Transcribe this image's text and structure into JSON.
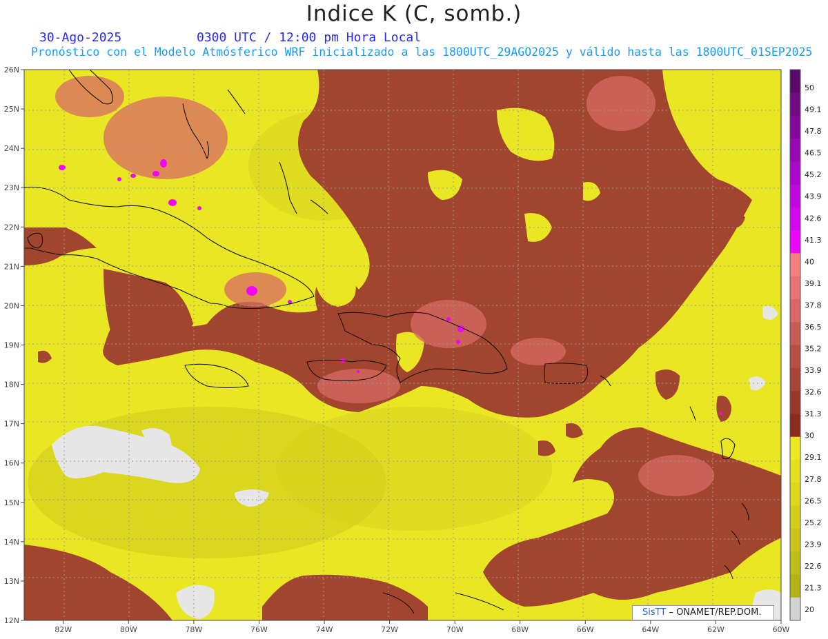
{
  "header": {
    "title": "Indice K (C, somb.)",
    "date": "30-Ago-2025",
    "time": "0300 UTC / 12:00 pm Hora Local",
    "subtitle": "Pronóstico con el Modelo Atmósferico WRF inicializado a las 1800UTC_29AGO2025 y válido hasta las  1800UTC_01SEP2025"
  },
  "credit": {
    "brand": "SisTT",
    "org": "– ONAMET/REP.DOM."
  },
  "map": {
    "lat_labels": [
      "26N",
      "25N",
      "24N",
      "23N",
      "22N",
      "21N",
      "20N",
      "19N",
      "18N",
      "17N",
      "16N",
      "15N",
      "14N",
      "13N",
      "12N"
    ],
    "lon_labels": [
      "82W",
      "80W",
      "78W",
      "76W",
      "74W",
      "72W",
      "70W",
      "68W",
      "66W",
      "64W",
      "62W",
      "60W"
    ],
    "lat_range": [
      12,
      26
    ],
    "lon_range": [
      -83.2,
      -60
    ]
  },
  "colorbar": {
    "labels": [
      "50",
      "49.1",
      "47.8",
      "46.5",
      "45.2",
      "43.9",
      "42.6",
      "41.3",
      "40",
      "39.1",
      "37.8",
      "36.5",
      "35.2",
      "33.9",
      "32.6",
      "31.3",
      "30",
      "29.1",
      "27.8",
      "26.5",
      "25.2",
      "23.9",
      "22.6",
      "21.3",
      "20"
    ],
    "colors": [
      "#5a0a6a",
      "#6e0a82",
      "#82099a",
      "#9609b2",
      "#aa08ca",
      "#be08e0",
      "#d207ee",
      "#ec06fa",
      "#f68080",
      "#e77474",
      "#d86868",
      "#c85b58",
      "#b84e48",
      "#a84338",
      "#98382a",
      "#8a2d1e",
      "#ece822",
      "#e4e020",
      "#dcd81e",
      "#d2ce1c",
      "#c8c41a",
      "#bebc18",
      "#b4b216",
      "#d3d3d3"
    ]
  }
}
